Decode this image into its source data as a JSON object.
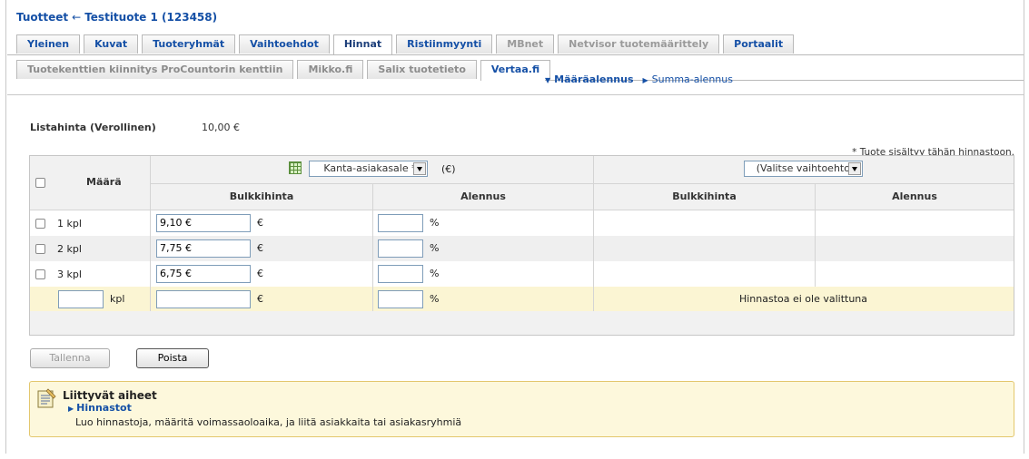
{
  "breadcrumb": {
    "root": "Tuotteet",
    "separator": "←",
    "current": "Testituote 1 (123458)"
  },
  "tabs_primary": [
    {
      "label": "Yleinen",
      "state": "normal"
    },
    {
      "label": "Kuvat",
      "state": "normal"
    },
    {
      "label": "Tuoteryhmät",
      "state": "normal"
    },
    {
      "label": "Vaihtoehdot",
      "state": "normal"
    },
    {
      "label": "Hinnat",
      "state": "active"
    },
    {
      "label": "Ristiinmyynti",
      "state": "normal"
    },
    {
      "label": "MBnet",
      "state": "disabled"
    },
    {
      "label": "Netvisor tuotemäärittely",
      "state": "disabled"
    },
    {
      "label": "Portaalit",
      "state": "normal"
    }
  ],
  "tabs_secondary": [
    {
      "label": "Tuotekenttien kiinnitys ProCountorin kenttiin",
      "state": "disabled"
    },
    {
      "label": "Mikko.fi",
      "state": "disabled"
    },
    {
      "label": "Salix tuotetieto",
      "state": "disabled"
    },
    {
      "label": "Vertaa.fi",
      "state": "active"
    }
  ],
  "subnav": {
    "current": "Määräalennus",
    "other": "Summa-alennus"
  },
  "list_price": {
    "label": "Listahinta (Verollinen)",
    "value": "10,00 €"
  },
  "note": "* Tuote sisältyy tähän hinnastoon.",
  "table": {
    "col_quantity": "Määrä",
    "pricelist_left": "Kanta-asiakasale *",
    "currency": "(€)",
    "pricelist_right": "(Valitse vaihtoehto)",
    "col_bulk": "Bulkkihinta",
    "col_discount": "Alennus",
    "euro": "€",
    "percent": "%",
    "unit": "kpl",
    "rows": [
      {
        "qty": "1 kpl",
        "bulk": "9,10 €",
        "discount": ""
      },
      {
        "qty": "2 kpl",
        "bulk": "7,75 €",
        "discount": ""
      },
      {
        "qty": "3 kpl",
        "bulk": "6,75 €",
        "discount": ""
      }
    ],
    "no_pricelist": "Hinnastoa ei ole valittuna"
  },
  "buttons": {
    "save": "Tallenna",
    "delete": "Poista"
  },
  "related": {
    "title": "Liittyvät aiheet",
    "link": "Hinnastot",
    "description": "Luo hinnastoja, määritä voimassaoloaika, ja liitä asiakkaita tai asiakasryhmiä"
  },
  "colors": {
    "link": "#1550a6",
    "new_row": "#fbf5d3",
    "alt_row": "#efefef",
    "related_bg": "#fdf8dc"
  }
}
